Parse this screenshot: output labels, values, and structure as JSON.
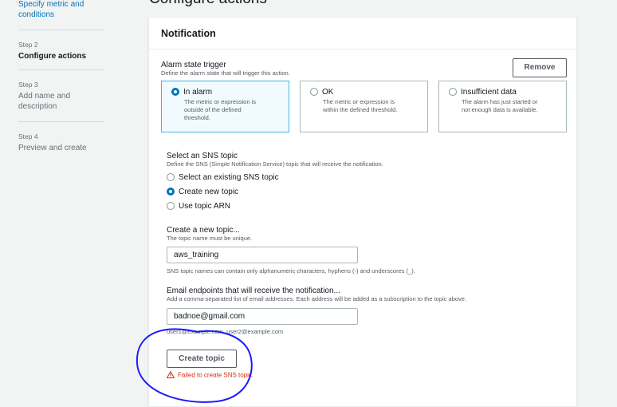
{
  "page_title": "Configure actions",
  "steps": [
    {
      "title": "Specify metric and conditions"
    },
    {
      "label": "Step 2",
      "title": "Configure actions"
    },
    {
      "label": "Step 3",
      "title": "Add name and description"
    },
    {
      "label": "Step 4",
      "title": "Preview and create"
    }
  ],
  "panel": {
    "title": "Notification",
    "trigger_label": "Alarm state trigger",
    "trigger_desc": "Define the alarm state that will trigger this action.",
    "remove_label": "Remove",
    "tiles": [
      {
        "title": "In alarm",
        "desc1": "The metric or expression is",
        "desc2": "outside of the defined",
        "desc3": "threshold.",
        "selected": true
      },
      {
        "title": "OK",
        "desc1": "The metric or expression is",
        "desc2": "within the defined threshold.",
        "desc3": "",
        "selected": false
      },
      {
        "title": "Insufficient data",
        "desc1": "The alarm has just started or",
        "desc2": "not enough data is available.",
        "desc3": "",
        "selected": false
      }
    ],
    "sns": {
      "label": "Select an SNS topic",
      "desc": "Define the SNS (Simple Notification Service) topic that will receive the notification.",
      "options": [
        "Select an existing SNS topic",
        "Create new topic",
        "Use topic ARN"
      ],
      "selected": "Create new topic"
    },
    "new_topic": {
      "label": "Create a new topic...",
      "desc": "The topic name must be unique.",
      "value": "aws_training",
      "hint": "SNS topic names can contain only alphanumeric characters, hyphens (-) and underscores (_)."
    },
    "email": {
      "label": "Email endpoints that will receive the notification...",
      "desc": "Add a comma-separated list of email addresses. Each address will be added as a subscription to the topic above.",
      "value": "badnoe@gmail.com",
      "hint": "user1@example.com, user2@example.com"
    },
    "create_button": "Create topic",
    "error": "Failed to create SNS topic."
  },
  "colors": {
    "accent": "#0073bb",
    "error": "#d13212",
    "annotation": "#1a1aff"
  }
}
